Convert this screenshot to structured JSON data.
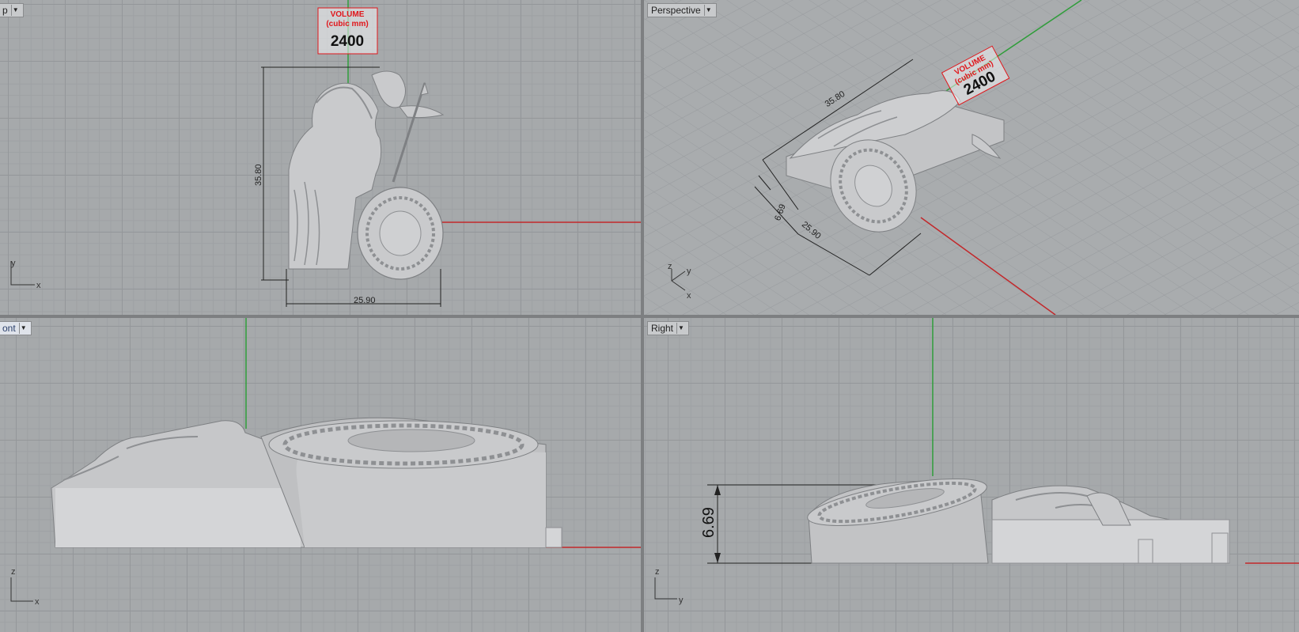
{
  "viewports": {
    "top": {
      "label": "p",
      "x_axis": "x",
      "y_axis": "y",
      "dim_height": "35.80",
      "dim_width": "25.90"
    },
    "perspective": {
      "label": "Perspective",
      "z_axis": "z",
      "y_axis": "y",
      "x_axis": "x",
      "dim_length": "35.80",
      "dim_depth": "6.69",
      "dim_width": "25.90"
    },
    "front": {
      "label": "ont",
      "z_axis": "z",
      "x_axis": "x"
    },
    "right": {
      "label": "Right",
      "z_axis": "z",
      "y_axis": "y",
      "dim_height": "6.69"
    }
  },
  "volume_tag": {
    "title": "VOLUME",
    "unit": "(cubic mm)",
    "value": "2400"
  },
  "colors": {
    "x_axis": "#c2282b",
    "y_axis": "#2f9d3a",
    "grid": "#94979a",
    "model": "#c9cacc"
  },
  "icons": [
    "dropdown-arrow-icon",
    "world-axes-icon"
  ]
}
